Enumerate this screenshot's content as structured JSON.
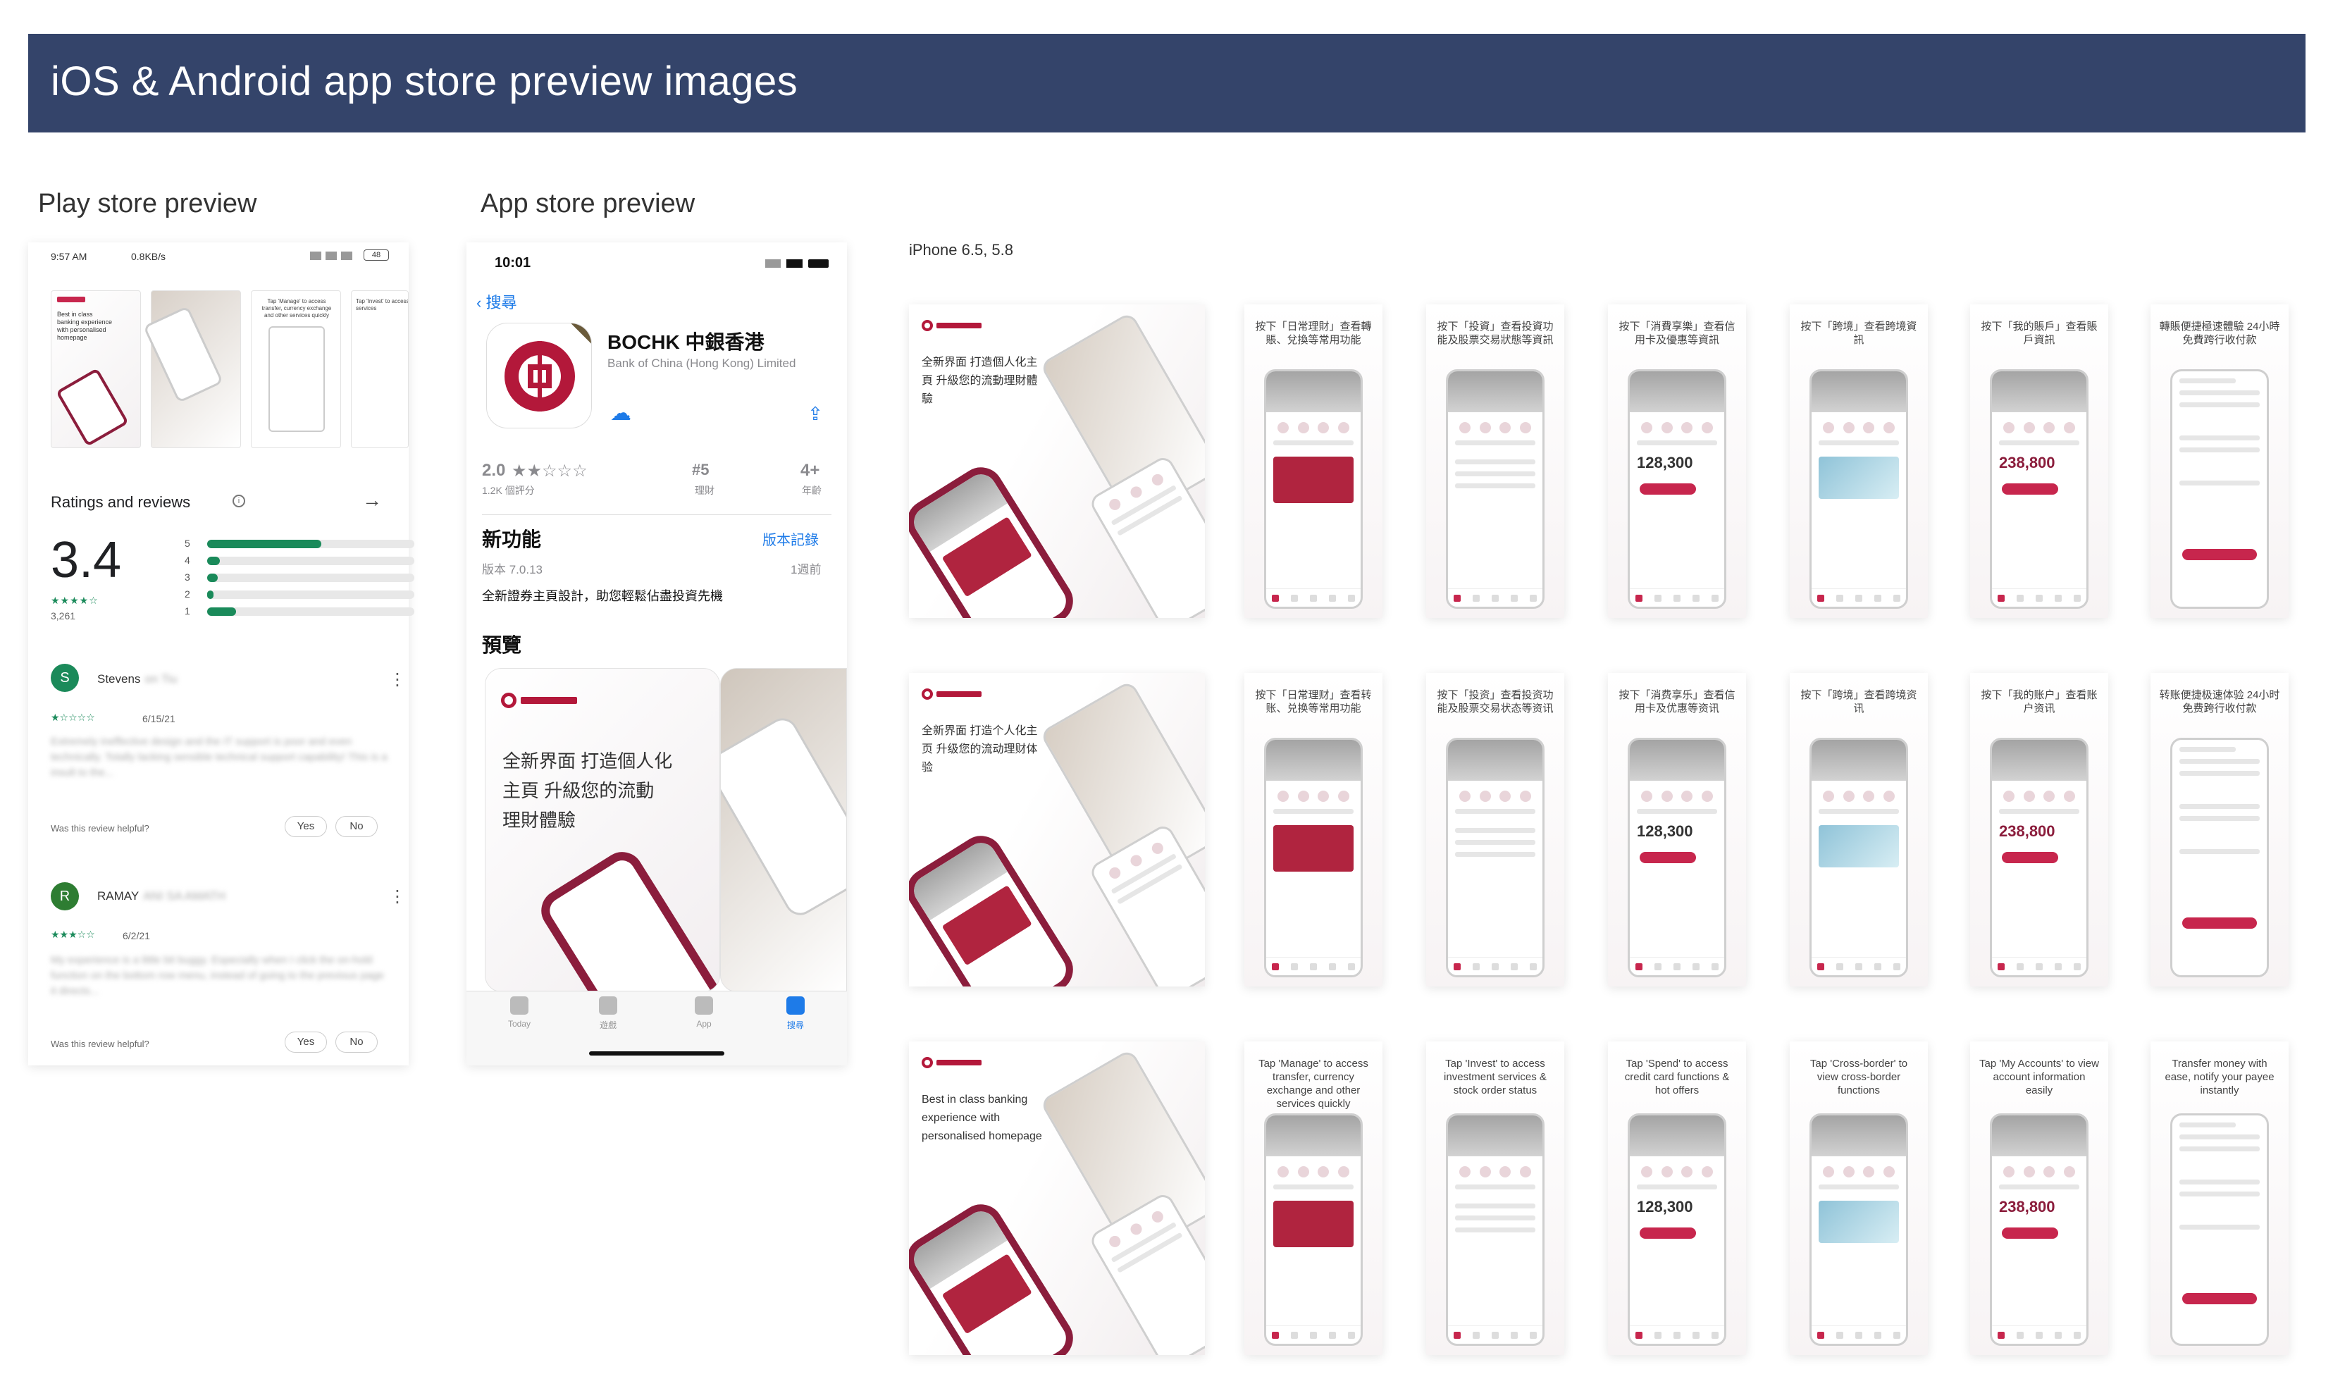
{
  "page_title": "iOS & Android app store preview images",
  "play": {
    "heading": "Play store preview",
    "status_time": "9:57 AM",
    "status_speed": "0.8KB/s",
    "battery": "48",
    "thumb_captions": [
      "Best in class banking experience with personalised homepage",
      "Tap 'Manage' to access transfer, currency exchange and other services quickly",
      "Tap 'Invest' to access investment services"
    ],
    "ratings_title": "Ratings and reviews",
    "rating": "3.4",
    "stars": "★★★★☆",
    "rating_count": "3,261",
    "bar_labels": [
      "5",
      "4",
      "3",
      "2",
      "1"
    ],
    "bar_fractions": [
      0.55,
      0.06,
      0.05,
      0.03,
      0.14
    ],
    "reviews": [
      {
        "initial": "S",
        "name": "Stevens",
        "name_hidden": "on Tiu",
        "stars": "★☆☆☆☆",
        "date": "6/15/21",
        "text": "Extremely ineffective design and the IT support is poor and even technically. Totally lacking sensible technical support capability! This is a insult to the...",
        "avatar_color": "#1b8a5a"
      },
      {
        "initial": "R",
        "name": "RAMAY",
        "name_hidden": "ANI SA AMATH",
        "stars": "★★★☆☆",
        "date": "6/2/21",
        "text": "My experience is a little bit buggy. Especially when I click the on-hold function on the bottom row menu, instead of going to the previous page it directs...",
        "avatar_color": "#2e7d32"
      }
    ],
    "helpful_label": "Was this review helpful?",
    "yes_label": "Yes",
    "no_label": "No"
  },
  "appstore": {
    "heading": "App store preview",
    "status_time": "10:01",
    "back_label": "搜尋",
    "new_badge": "NEW",
    "app_name": "BOCHK 中銀香港",
    "developer": "Bank of China (Hong Kong) Limited",
    "rating": "2.0",
    "rating_stars": "★★☆☆☆",
    "rating_count": "1.2K 個評分",
    "rank": "#5",
    "rank_label": "理財",
    "age": "4+",
    "age_label": "年齡",
    "whats_new_title": "新功能",
    "version_history": "版本記錄",
    "version": "版本 7.0.13",
    "version_age": "1週前",
    "release_note": "全新證券主頁設計，助您輕鬆佔盡投資先機",
    "preview_title": "預覽",
    "preview_card_text": [
      "全新界面 打造個人化",
      "主頁 升級您的流動",
      "理財體驗"
    ],
    "tabs": [
      "Today",
      "遊戲",
      "App",
      "搜尋"
    ]
  },
  "grid": {
    "device_label": "iPhone 6.5, 5.8",
    "rows": [
      {
        "hero": "全新界面 打造個人化主頁 升級您的流動理財體驗",
        "cards": [
          {
            "title": "按下「日常理財」查看轉賬、兌換等常用功能"
          },
          {
            "title": "按下「投資」查看投資功能及股票交易狀態等資訊"
          },
          {
            "title": "按下「消費享樂」查看信用卡及優惠等資訊",
            "number": "128,300"
          },
          {
            "title": "按下「跨境」查看跨境資訊"
          },
          {
            "title": "按下「我的賬戶」查看賬戶資訊",
            "number": "238,800"
          },
          {
            "title": "轉賬便捷極速體驗 24小時免費跨行收付款"
          }
        ]
      },
      {
        "hero": "全新界面 打造个人化主页 升级您的流动理财体验",
        "cards": [
          {
            "title": "按下「日常理财」查看转账、兑换等常用功能"
          },
          {
            "title": "按下「投资」查看投资功能及股票交易状态等资讯"
          },
          {
            "title": "按下「消费享乐」查看信用卡及优惠等资讯",
            "number": "128,300"
          },
          {
            "title": "按下「跨境」查看跨境资讯"
          },
          {
            "title": "按下「我的账户」查看账户资讯",
            "number": "238,800"
          },
          {
            "title": "转账便捷极速体验 24小时免费跨行收付款"
          }
        ]
      },
      {
        "hero": "Best in class banking experience with personalised homepage",
        "cards": [
          {
            "title": "Tap 'Manage' to access transfer, currency exchange and other services quickly"
          },
          {
            "title": "Tap 'Invest' to access investment services & stock order status"
          },
          {
            "title": "Tap 'Spend' to access credit card functions & hot offers",
            "number": "128,300"
          },
          {
            "title": "Tap 'Cross-border' to view cross-border functions"
          },
          {
            "title": "Tap 'My Accounts' to view account information easily",
            "number": "238,800"
          },
          {
            "title": "Transfer money with ease, notify your payee instantly"
          }
        ]
      }
    ]
  }
}
